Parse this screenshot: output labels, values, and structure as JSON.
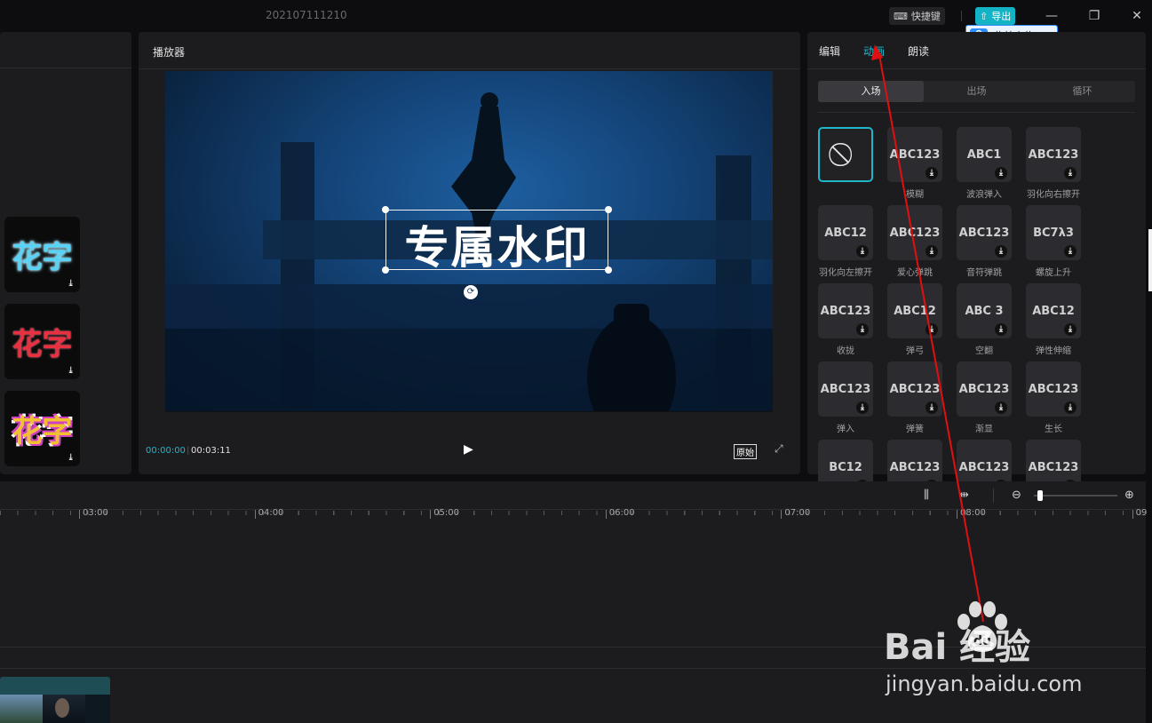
{
  "titlebar": {
    "project_name": "202107111210",
    "shortcut_label": "快捷键",
    "export_label": "导出",
    "upload_tip": "拖拽上传"
  },
  "left_panel": {
    "stickers": [
      {
        "text": "花字",
        "color": "#58d2f5"
      },
      {
        "text": "花字",
        "color": "#e83040"
      },
      {
        "text": "花字",
        "color": "#f0c030"
      }
    ]
  },
  "player": {
    "title": "播放器",
    "watermark_text": "专属水印",
    "time_current": "00:00:00",
    "time_total": "00:03:11",
    "ratio_label": "原始"
  },
  "right_panel": {
    "tabs": [
      "编辑",
      "动画",
      "朗读"
    ],
    "active_tab": "动画",
    "segments": [
      "入场",
      "出场",
      "循环"
    ],
    "active_segment": "入场",
    "animations": [
      {
        "preview": "⃠",
        "label": ""
      },
      {
        "preview": "ABC123",
        "label": "模糊"
      },
      {
        "preview": "ABC1",
        "label": "波浪弹入"
      },
      {
        "preview": "ABC123",
        "label": "羽化向右擦开"
      },
      {
        "preview": "ABC12",
        "label": "羽化向左擦开"
      },
      {
        "preview": "ABC123",
        "label": "爱心弹跳"
      },
      {
        "preview": "ABC123",
        "label": "音符弹跳"
      },
      {
        "preview": "BC7λ3",
        "label": "螺旋上升"
      },
      {
        "preview": "ABC123",
        "label": "收拢"
      },
      {
        "preview": "ABC12",
        "label": "弹弓"
      },
      {
        "preview": "ABC 3",
        "label": "空翻"
      },
      {
        "preview": "ABC12",
        "label": "弹性伸缩"
      },
      {
        "preview": "ABC123",
        "label": "弹入"
      },
      {
        "preview": "ABC123",
        "label": "弹簧"
      },
      {
        "preview": "ABC123",
        "label": "渐显"
      },
      {
        "preview": "ABC123",
        "label": "生长"
      },
      {
        "preview": "BC12",
        "label": ""
      },
      {
        "preview": "ABC123",
        "label": ""
      },
      {
        "preview": "ABC123",
        "label": ""
      },
      {
        "preview": "ABC123",
        "label": ""
      }
    ]
  },
  "timeline": {
    "ticks": [
      "03:00",
      "04:00",
      "05:00",
      "06:00",
      "07:00",
      "08:00",
      "09"
    ]
  },
  "overlay": {
    "baidu_word": "Bai   经验",
    "baidu_url": "jingyan.baidu.com"
  },
  "colors": {
    "accent": "#1fb6c9",
    "annotation_arrow": "#e01010"
  }
}
